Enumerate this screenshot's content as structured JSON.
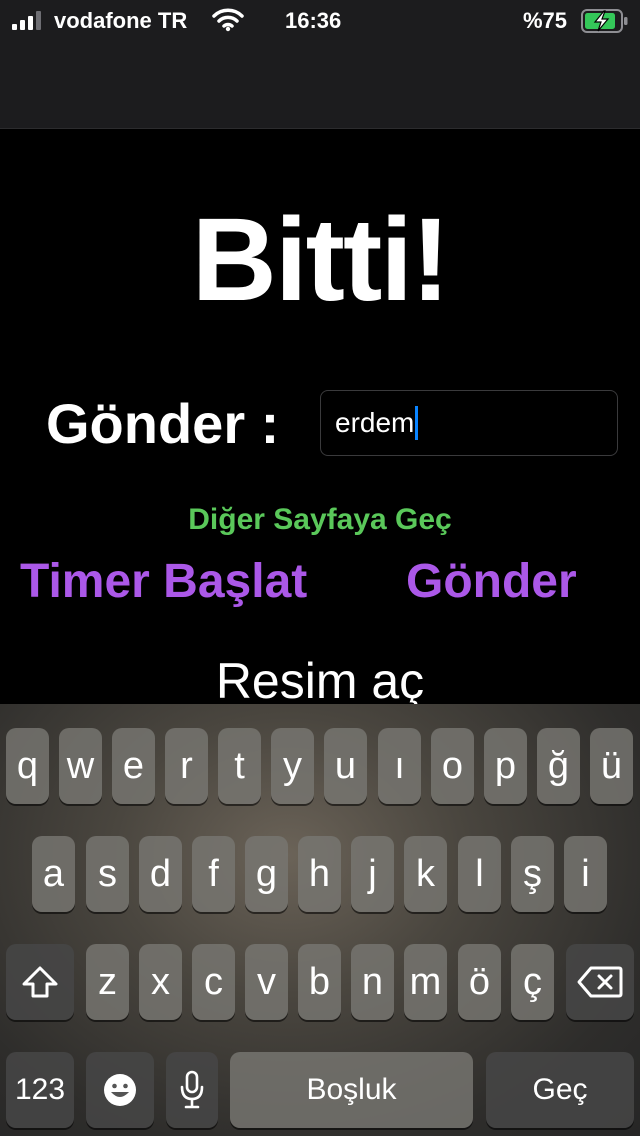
{
  "status_bar": {
    "carrier": "vodafone TR",
    "time": "16:36",
    "battery_percent": "%75",
    "icons": [
      "signal-icon",
      "wifi-icon",
      "battery-charging-icon"
    ]
  },
  "main": {
    "title": "Bitti!",
    "send_label": "Gönder :",
    "name_input_value": "erdem",
    "next_page_link": "Diğer Sayfaya Geç",
    "timer_button": "Timer Başlat",
    "send_button": "Gönder",
    "open_image_button": "Resim aç"
  },
  "colors": {
    "accent_purple": "#ab58e8",
    "accent_green": "#5ac85a",
    "caret_blue": "#0a84ff"
  },
  "keyboard": {
    "row1": [
      "q",
      "w",
      "e",
      "r",
      "t",
      "y",
      "u",
      "ı",
      "o",
      "p",
      "ğ",
      "ü"
    ],
    "row2": [
      "a",
      "s",
      "d",
      "f",
      "g",
      "h",
      "j",
      "k",
      "l",
      "ş",
      "i"
    ],
    "row3": [
      "z",
      "x",
      "c",
      "v",
      "b",
      "n",
      "m",
      "ö",
      "ç"
    ],
    "numbers_key": "123",
    "space_key": "Boşluk",
    "return_key": "Geç",
    "icons": [
      "shift-icon",
      "backspace-icon",
      "emoji-icon",
      "microphone-icon"
    ]
  }
}
